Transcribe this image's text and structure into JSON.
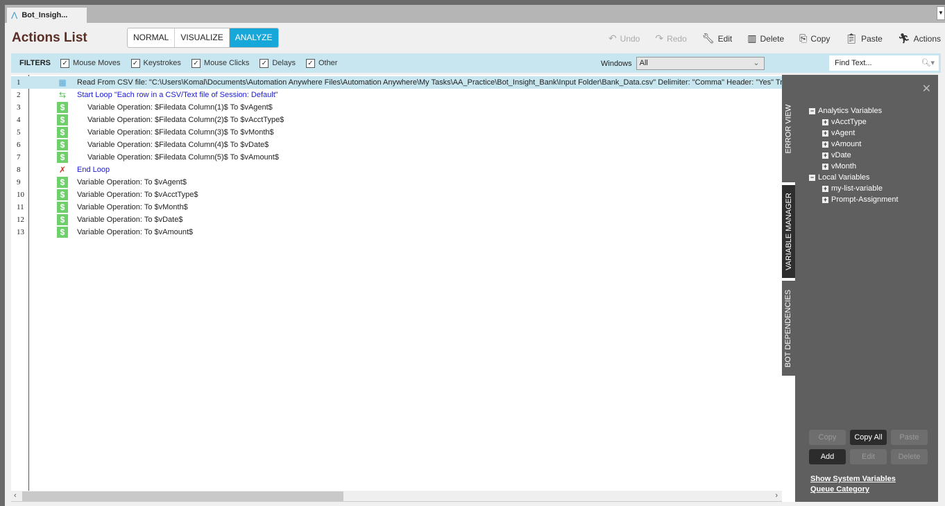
{
  "tab": {
    "title": "Bot_Insigh..."
  },
  "header": {
    "title": "Actions List",
    "modes": [
      "NORMAL",
      "VISUALIZE",
      "ANALYZE"
    ],
    "active_mode": "ANALYZE"
  },
  "toolbar": {
    "undo": "Undo",
    "redo": "Redo",
    "edit": "Edit",
    "delete": "Delete",
    "copy": "Copy",
    "paste": "Paste",
    "actions": "Actions"
  },
  "filters": {
    "label": "FILTERS",
    "items": [
      "Mouse Moves",
      "Keystrokes",
      "Mouse Clicks",
      "Delays",
      "Other"
    ],
    "windows_label": "Windows",
    "windows_value": "All",
    "find_placeholder": "Find Text..."
  },
  "actions": [
    {
      "n": "1",
      "icon": "table-icon",
      "text": "Read From CSV file: \"C:\\Users\\Komal\\Documents\\Automation Anywhere Files\\Automation Anywhere\\My Tasks\\AA_Practice\\Bot_Insight_Bank\\Input Folder\\Bank_Data.csv\" Delimiter: \"Comma\" Header: \"Yes\" Trim"
    },
    {
      "n": "2",
      "icon": "loop-icon",
      "text": "Start Loop \"Each row in a CSV/Text file of Session: Default\""
    },
    {
      "n": "3",
      "icon": "dollar-icon",
      "text": "Variable Operation: $Filedata Column(1)$ To $vAgent$"
    },
    {
      "n": "4",
      "icon": "dollar-icon",
      "text": "Variable Operation: $Filedata Column(2)$ To $vAcctType$"
    },
    {
      "n": "5",
      "icon": "dollar-icon",
      "text": "Variable Operation: $Filedata Column(3)$ To $vMonth$"
    },
    {
      "n": "6",
      "icon": "dollar-icon",
      "text": "Variable Operation: $Filedata Column(4)$ To $vDate$"
    },
    {
      "n": "7",
      "icon": "dollar-icon",
      "text": "Variable Operation: $Filedata Column(5)$ To $vAmount$"
    },
    {
      "n": "8",
      "icon": "end-loop-icon",
      "text": "End Loop"
    },
    {
      "n": "9",
      "icon": "dollar-icon",
      "text": "Variable Operation:  To $vAgent$"
    },
    {
      "n": "10",
      "icon": "dollar-icon",
      "text": "Variable Operation:  To $vAcctType$"
    },
    {
      "n": "11",
      "icon": "dollar-icon",
      "text": "Variable Operation:  To $vMonth$"
    },
    {
      "n": "12",
      "icon": "dollar-icon",
      "text": "Variable Operation:  To $vDate$"
    },
    {
      "n": "13",
      "icon": "dollar-icon",
      "text": "Variable Operation:  To $vAmount$"
    }
  ],
  "side_tabs": [
    "ERROR VIEW",
    "VARIABLE MANAGER",
    "BOT DEPENDENCIES"
  ],
  "variables": {
    "analytics_label": "Analytics Variables",
    "analytics": [
      "vAcctType",
      "vAgent",
      "vAmount",
      "vDate",
      "vMonth"
    ],
    "local_label": "Local Variables",
    "local": [
      "my-list-variable",
      "Prompt-Assignment"
    ],
    "buttons": {
      "copy": "Copy",
      "copy_all": "Copy All",
      "paste": "Paste",
      "add": "Add",
      "edit": "Edit",
      "delete": "Delete"
    },
    "links": {
      "system": "Show System Variables",
      "queue": "Queue Category"
    }
  },
  "colors": {
    "accent": "#18a7d9",
    "filter_bar": "#c8e6ef",
    "panel": "#5f5f5f",
    "loop_text": "#1a1ad0",
    "dollar_icon": "#6fcf6a"
  }
}
